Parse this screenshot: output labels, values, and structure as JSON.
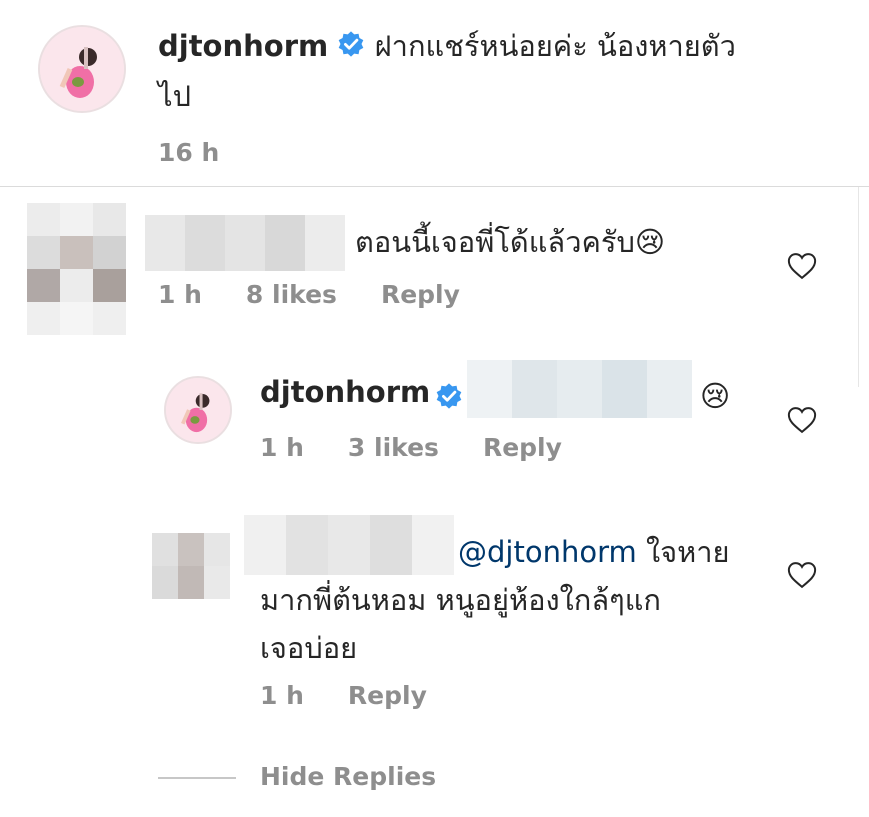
{
  "post_caption": {
    "username": "djtonhorm",
    "text_line1": "ฝากแชร์หน่อยค่ะ น้องหายตัว",
    "text_line2": "ไป",
    "time": "16 h"
  },
  "comments": [
    {
      "text": "ตอนนี้เจอพี่โด้แล้วครับ",
      "emoji": "😢",
      "time": "1 h",
      "likes": "8 likes",
      "reply_label": "Reply"
    },
    {
      "username": "djtonhorm",
      "emoji": "😢",
      "time": "1 h",
      "likes": "3 likes",
      "reply_label": "Reply"
    },
    {
      "mention": "@djtonhorm",
      "text_line1_suffix": "ใจหาย",
      "text_line2": "มากพี่ต้นหอม หนูอยู่ห้องใกล้ๆแก",
      "text_line3": "เจอบ่อย",
      "time": "1 h",
      "reply_label": "Reply"
    }
  ],
  "hide_replies_label": "Hide Replies",
  "colors": {
    "verified": "#3897f0",
    "meta_gray": "#8e8e8e",
    "mention": "#00376b"
  }
}
